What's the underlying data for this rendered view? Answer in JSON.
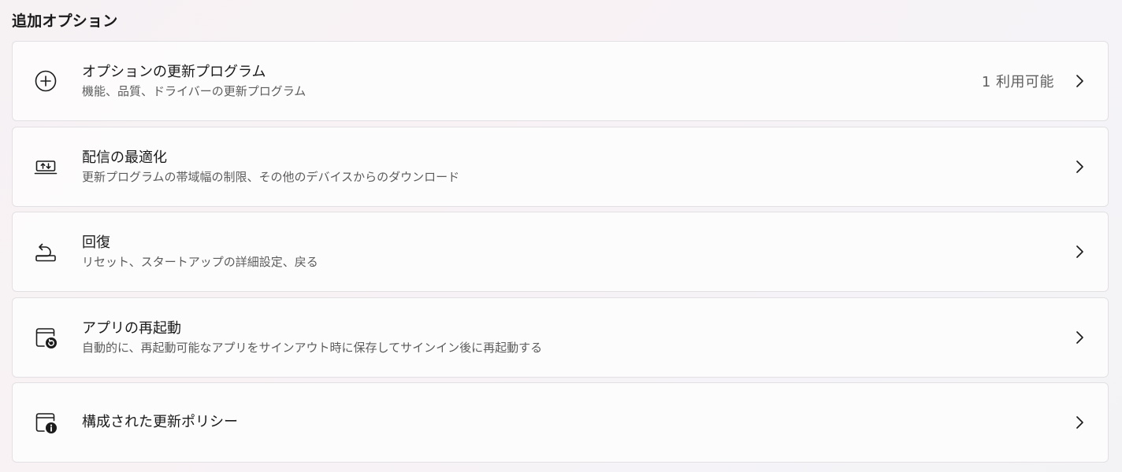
{
  "section": {
    "title": "追加オプション"
  },
  "items": [
    {
      "icon": "plus-circle-icon",
      "title": "オプションの更新プログラム",
      "description": "機能、品質、ドライバーの更新プログラム",
      "status": "1 利用可能"
    },
    {
      "icon": "delivery-optimization-icon",
      "title": "配信の最適化",
      "description": "更新プログラムの帯域幅の制限、その他のデバイスからのダウンロード",
      "status": ""
    },
    {
      "icon": "recovery-icon",
      "title": "回復",
      "description": "リセット、スタートアップの詳細設定、戻る",
      "status": ""
    },
    {
      "icon": "app-restart-icon",
      "title": "アプリの再起動",
      "description": "自動的に、再起動可能なアプリをサインアウト時に保存してサインイン後に再起動する",
      "status": ""
    },
    {
      "icon": "policy-info-icon",
      "title": "構成された更新ポリシー",
      "description": "",
      "status": ""
    }
  ],
  "colors": {
    "card_background": "#ffffff",
    "card_border": "#e3e0e3",
    "title_text": "#1b1b1b",
    "description_text": "#5c5c5c"
  }
}
